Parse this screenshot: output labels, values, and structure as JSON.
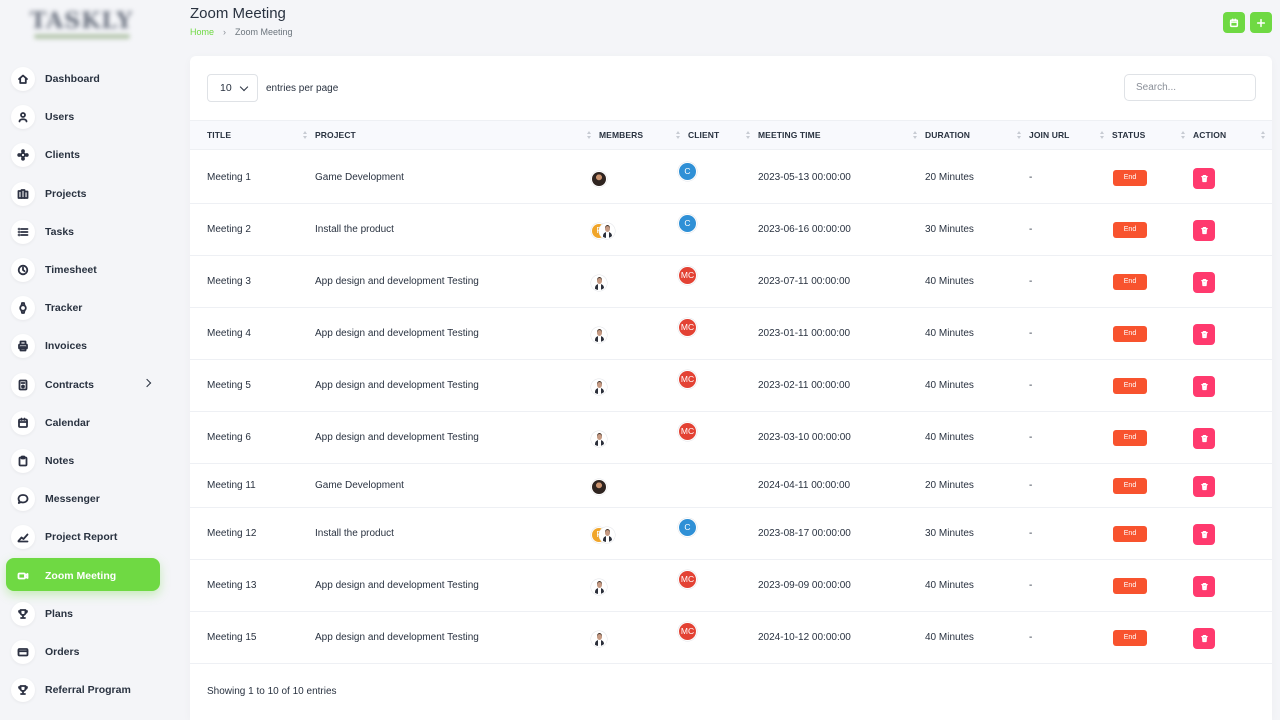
{
  "header": {
    "title": "Zoom Meeting",
    "breadcrumb": {
      "home": "Home",
      "current": "Zoom Meeting"
    },
    "buttons": [
      {
        "name": "calendar-view-button",
        "icon": "calendar-icon"
      },
      {
        "name": "create-meeting-button",
        "icon": "plus-icon"
      }
    ]
  },
  "sidebar": {
    "items": [
      {
        "label": "Dashboard",
        "icon": "home-icon"
      },
      {
        "label": "Users",
        "icon": "user-icon"
      },
      {
        "label": "Clients",
        "icon": "clients-icon"
      },
      {
        "label": "Projects",
        "icon": "projects-icon"
      },
      {
        "label": "Tasks",
        "icon": "list-icon"
      },
      {
        "label": "Timesheet",
        "icon": "clock-icon"
      },
      {
        "label": "Tracker",
        "icon": "watch-icon"
      },
      {
        "label": "Invoices",
        "icon": "printer-icon"
      },
      {
        "label": "Contracts",
        "icon": "device-icon",
        "has_submenu": true
      },
      {
        "label": "Calendar",
        "icon": "calendar-icon"
      },
      {
        "label": "Notes",
        "icon": "clipboard-icon"
      },
      {
        "label": "Messenger",
        "icon": "message-icon"
      },
      {
        "label": "Project Report",
        "icon": "chart-line-icon"
      },
      {
        "label": "Zoom Meeting",
        "icon": "video-icon",
        "active": true
      },
      {
        "label": "Plans",
        "icon": "trophy-icon"
      },
      {
        "label": "Orders",
        "icon": "credit-card-icon"
      },
      {
        "label": "Referral Program",
        "icon": "trophy-icon"
      }
    ]
  },
  "controls": {
    "entries_value": "10",
    "entries_label": "entries per page",
    "search_placeholder": "Search..."
  },
  "table": {
    "columns": [
      "TITLE",
      "PROJECT",
      "MEMBERS",
      "CLIENT",
      "MEETING TIME",
      "DURATION",
      "JOIN URL",
      "STATUS",
      "ACTION"
    ],
    "rows": [
      {
        "title": "Meeting 1",
        "project": "Game Development",
        "members": [
          "photo-dark"
        ],
        "client": {
          "text": "C",
          "color": "#2f90d6"
        },
        "meeting_time": "2023-05-13 00:00:00",
        "duration": "20 Minutes",
        "join_url": "-",
        "status": "End"
      },
      {
        "title": "Meeting 2",
        "project": "Install the product",
        "members": [
          "P",
          "photo-man"
        ],
        "client": {
          "text": "C",
          "color": "#2f90d6"
        },
        "meeting_time": "2023-06-16 00:00:00",
        "duration": "30 Minutes",
        "join_url": "-",
        "status": "End"
      },
      {
        "title": "Meeting 3",
        "project": "App design and development Testing",
        "members": [
          "photo-man"
        ],
        "client": {
          "text": "MC",
          "color": "#e34234"
        },
        "meeting_time": "2023-07-11 00:00:00",
        "duration": "40 Minutes",
        "join_url": "-",
        "status": "End"
      },
      {
        "title": "Meeting 4",
        "project": "App design and development Testing",
        "members": [
          "photo-man"
        ],
        "client": {
          "text": "MC",
          "color": "#e34234"
        },
        "meeting_time": "2023-01-11 00:00:00",
        "duration": "40 Minutes",
        "join_url": "-",
        "status": "End"
      },
      {
        "title": "Meeting 5",
        "project": "App design and development Testing",
        "members": [
          "photo-man"
        ],
        "client": {
          "text": "MC",
          "color": "#e34234"
        },
        "meeting_time": "2023-02-11 00:00:00",
        "duration": "40 Minutes",
        "join_url": "-",
        "status": "End"
      },
      {
        "title": "Meeting 6",
        "project": "App design and development Testing",
        "members": [
          "photo-man"
        ],
        "client": {
          "text": "MC",
          "color": "#e34234"
        },
        "meeting_time": "2023-03-10 00:00:00",
        "duration": "40 Minutes",
        "join_url": "-",
        "status": "End"
      },
      {
        "title": "Meeting 11",
        "project": "Game Development",
        "members": [
          "photo-dark"
        ],
        "client": null,
        "meeting_time": "2024-04-11 00:00:00",
        "duration": "20 Minutes",
        "join_url": "-",
        "status": "End"
      },
      {
        "title": "Meeting 12",
        "project": "Install the product",
        "members": [
          "P",
          "photo-man"
        ],
        "client": {
          "text": "C",
          "color": "#2f90d6"
        },
        "meeting_time": "2023-08-17 00:00:00",
        "duration": "30 Minutes",
        "join_url": "-",
        "status": "End"
      },
      {
        "title": "Meeting 13",
        "project": "App design and development Testing",
        "members": [
          "photo-man"
        ],
        "client": {
          "text": "MC",
          "color": "#e34234"
        },
        "meeting_time": "2023-09-09 00:00:00",
        "duration": "40 Minutes",
        "join_url": "-",
        "status": "End"
      },
      {
        "title": "Meeting 15",
        "project": "App design and development Testing",
        "members": [
          "photo-man"
        ],
        "client": {
          "text": "MC",
          "color": "#e34234"
        },
        "meeting_time": "2024-10-12 00:00:00",
        "duration": "40 Minutes",
        "join_url": "-",
        "status": "End"
      }
    ]
  },
  "footer": {
    "info": "Showing 1 to 10 of 10 entries"
  },
  "colors": {
    "accent": "#6fd943",
    "danger": "#ff3a6e",
    "status_end": "#f8532e"
  }
}
